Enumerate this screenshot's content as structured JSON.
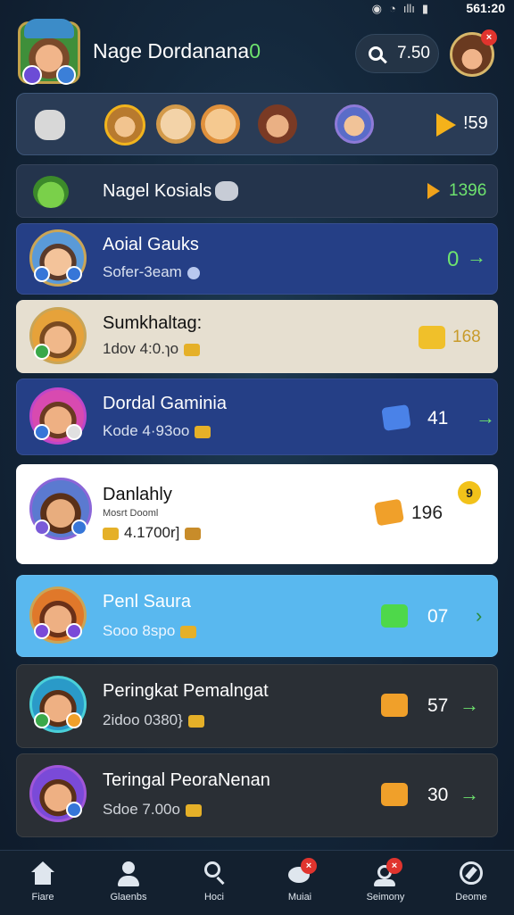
{
  "status_bar": {
    "icons": [
      "◉",
      "◔",
      "ıllı",
      "▮"
    ],
    "time": "561:20"
  },
  "header": {
    "player_name": "Nage Dordanana",
    "online_mark": "0",
    "coins": "7.50",
    "notification_count": "×"
  },
  "friends_strip": {
    "count": "!59"
  },
  "rows": [
    {
      "title": "Nagel Kosials",
      "score": "1396"
    },
    {
      "title": "Aoial Gauks",
      "subtitle": "Sofer-3eam",
      "score": "0"
    },
    {
      "title": "Sumkhaltag:",
      "subtitle": "1dov 4:0.ɿo",
      "score": "168"
    },
    {
      "title": "Dordal Gaminia",
      "subtitle": "Kode 4·93oo",
      "score": "41"
    },
    {
      "title": "Danlahly",
      "small": "Mosrt Dooml",
      "subtitle": "4.1700r]",
      "score": "196",
      "badge": "9"
    },
    {
      "title": "Penl Saura",
      "subtitle": "Sooo 8spo",
      "score": "07"
    },
    {
      "title": "Peringkat Pemalngat",
      "subtitle": "2idoo 0380}",
      "score": "57"
    },
    {
      "title": "Teringal PeoraNenan",
      "subtitle": "Sdoe 7.00o",
      "score": "30"
    }
  ],
  "nav": [
    {
      "label": "Fiare"
    },
    {
      "label": "Glaenbs"
    },
    {
      "label": "Hoci"
    },
    {
      "label": "Muiai",
      "badge": "×"
    },
    {
      "label": "Seimony",
      "badge": "×"
    },
    {
      "label": "Deome"
    }
  ],
  "colors": {
    "accent_green": "#6ee36e",
    "coin_gold": "#e5b028",
    "row_blue": "#253f86",
    "row_cream": "#e6dfd0",
    "row_white": "#ffffff",
    "row_light_blue": "#59b8ef",
    "row_dark": "#2a2f35"
  }
}
